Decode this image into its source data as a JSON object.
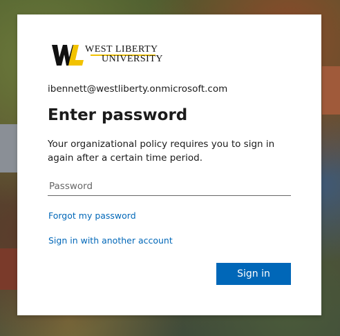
{
  "logo": {
    "line1": "WEST LIBERTY",
    "line2": "UNIVERSITY",
    "brand_colors": {
      "black": "#111111",
      "gold": "#f2c200"
    }
  },
  "account": {
    "email": "ibennett@westliberty.onmicrosoft.com"
  },
  "page": {
    "title": "Enter password",
    "description": "Your organizational policy requires you to sign in again after a certain time period."
  },
  "password_field": {
    "placeholder": "Password",
    "value": ""
  },
  "links": {
    "forgot": "Forgot my password",
    "another_account": "Sign in with another account"
  },
  "actions": {
    "sign_in": "Sign in"
  },
  "colors": {
    "accent": "#0067b8",
    "text": "#1b1b1b",
    "card": "#ffffff"
  }
}
